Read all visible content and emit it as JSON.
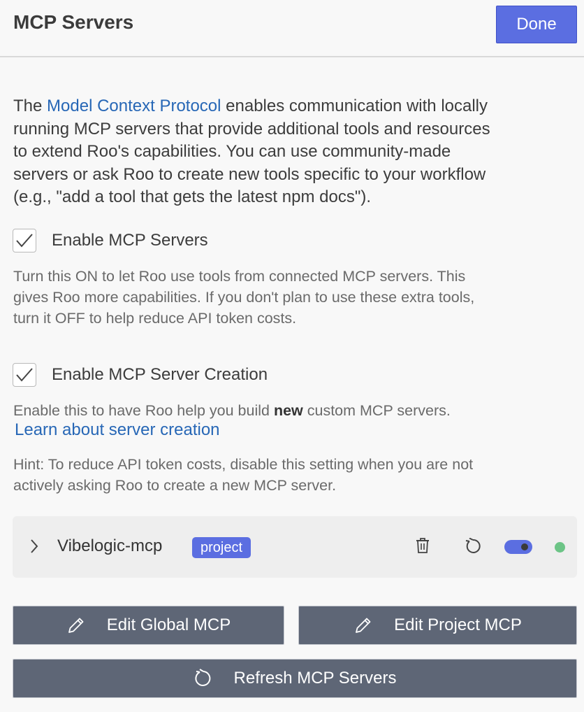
{
  "header": {
    "title": "MCP Servers",
    "done_label": "Done"
  },
  "intro": {
    "prefix": "The ",
    "link_text": "Model Context Protocol",
    "line1_rest": " enables communication with locally",
    "line2": "running MCP servers that provide additional tools and resources",
    "line3": "to extend Roo's capabilities. You can use community-made",
    "line4": "servers or ask Roo to create new tools specific to your workflow",
    "line5": "(e.g., \"add a tool that gets the latest npm docs\")."
  },
  "enable_servers": {
    "label": "Enable MCP Servers",
    "checked": true,
    "desc_line1": "Turn this ON to let Roo use tools from connected MCP servers. This",
    "desc_line2": "gives Roo more capabilities. If you don't plan to use these extra tools,",
    "desc_line3": "turn it OFF to help reduce API token costs."
  },
  "enable_creation": {
    "label": "Enable MCP Server Creation",
    "checked": true,
    "desc_prefix": "Enable this to have Roo help you build ",
    "desc_bold": "new",
    "desc_suffix": " custom MCP servers.",
    "learn_link": "Learn about server creation",
    "hint_line1": "Hint: To reduce API token costs, disable this setting when you are not",
    "hint_line2": "actively asking Roo to create a new MCP server."
  },
  "servers": [
    {
      "name": "Vibelogic-mcp",
      "badge": "project",
      "enabled": true,
      "status": "connected",
      "status_color": "#6cc486"
    }
  ],
  "actions": {
    "edit_global": "Edit Global MCP",
    "edit_project": "Edit Project MCP",
    "refresh": "Refresh MCP Servers"
  },
  "colors": {
    "accent": "#5b6ee1",
    "link": "#2767b6",
    "button_bg": "#5e6676"
  },
  "icons": {
    "checkbox": "check-icon",
    "expand": "chevron-right-icon",
    "delete": "trash-icon",
    "restart": "restart-icon",
    "edit": "pencil-icon",
    "refresh": "refresh-icon"
  }
}
